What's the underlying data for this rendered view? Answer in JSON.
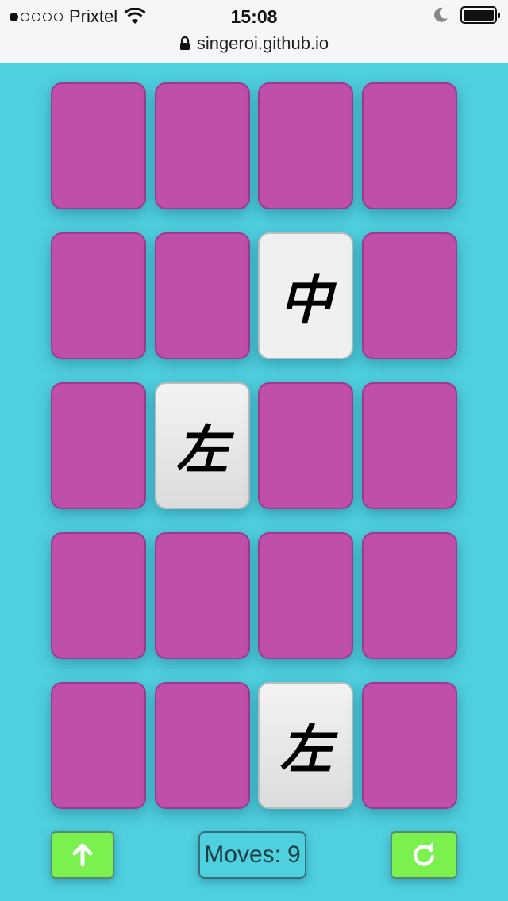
{
  "status_bar": {
    "carrier": "Prixtel",
    "time": "15:08",
    "url": "singeroi.github.io",
    "signal_bars_filled": 1,
    "signal_bars_total": 5,
    "battery_level": 1.0
  },
  "board": {
    "rows": 5,
    "cols": 4,
    "card_back_color": "#c04fa9",
    "cards": [
      {
        "face": "down",
        "glyph": ""
      },
      {
        "face": "down",
        "glyph": ""
      },
      {
        "face": "down",
        "glyph": ""
      },
      {
        "face": "down",
        "glyph": ""
      },
      {
        "face": "down",
        "glyph": ""
      },
      {
        "face": "down",
        "glyph": ""
      },
      {
        "face": "up",
        "glyph": "中"
      },
      {
        "face": "down",
        "glyph": ""
      },
      {
        "face": "down",
        "glyph": ""
      },
      {
        "face": "up",
        "glyph": "左"
      },
      {
        "face": "down",
        "glyph": ""
      },
      {
        "face": "down",
        "glyph": ""
      },
      {
        "face": "down",
        "glyph": ""
      },
      {
        "face": "down",
        "glyph": ""
      },
      {
        "face": "down",
        "glyph": ""
      },
      {
        "face": "down",
        "glyph": ""
      },
      {
        "face": "down",
        "glyph": ""
      },
      {
        "face": "down",
        "glyph": ""
      },
      {
        "face": "up",
        "glyph": "左"
      },
      {
        "face": "down",
        "glyph": ""
      }
    ]
  },
  "controls": {
    "up_button_icon": "arrow-up-icon",
    "reset_button_icon": "reload-icon",
    "moves_label": "Moves:",
    "moves_value": "9",
    "button_color": "#7bf14f"
  }
}
